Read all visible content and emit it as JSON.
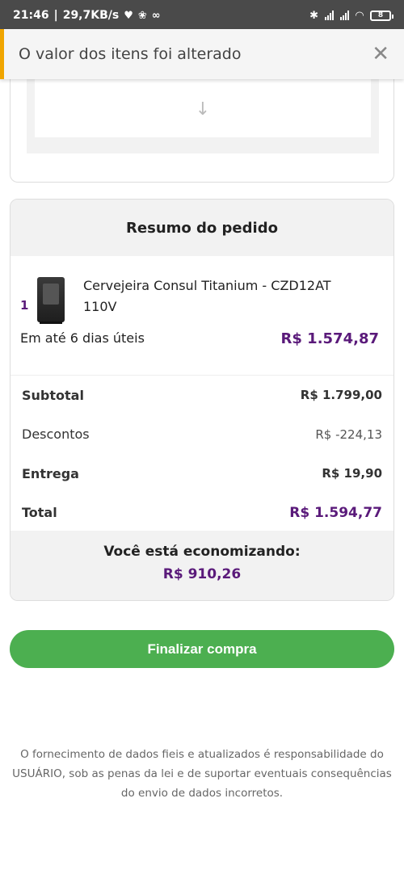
{
  "status_bar": {
    "time": "21:46",
    "speed": "29,7KB/s",
    "battery": "8"
  },
  "toast": {
    "message": "O valor dos itens foi alterado",
    "close_icon": "close-icon"
  },
  "summary": {
    "title": "Resumo do pedido",
    "item": {
      "quantity": "1",
      "name": "Cervejeira Consul Titanium - CZD12AT 110V",
      "delivery": "Em até 6 dias úteis",
      "price": "R$ 1.574,87"
    },
    "rows": {
      "subtotal_label": "Subtotal",
      "subtotal_value": "R$ 1.799,00",
      "discount_label": "Descontos",
      "discount_value": "R$ -224,13",
      "shipping_label": "Entrega",
      "shipping_value": "R$ 19,90",
      "total_label": "Total",
      "total_value": "R$ 1.594,77"
    },
    "saving": {
      "label": "Você está economizando:",
      "value": "R$ 910,26"
    }
  },
  "checkout_button": "Finalizar compra",
  "disclaimer": "O fornecimento de dados fieis e atualizados é responsabilidade do USUÁRIO, sob as penas da lei e de suportar eventuais consequências do envio de dados incorretos.",
  "colors": {
    "accent_purple": "#5a1a7a",
    "button_green": "#4caf50",
    "toast_warning": "#f0a500"
  }
}
